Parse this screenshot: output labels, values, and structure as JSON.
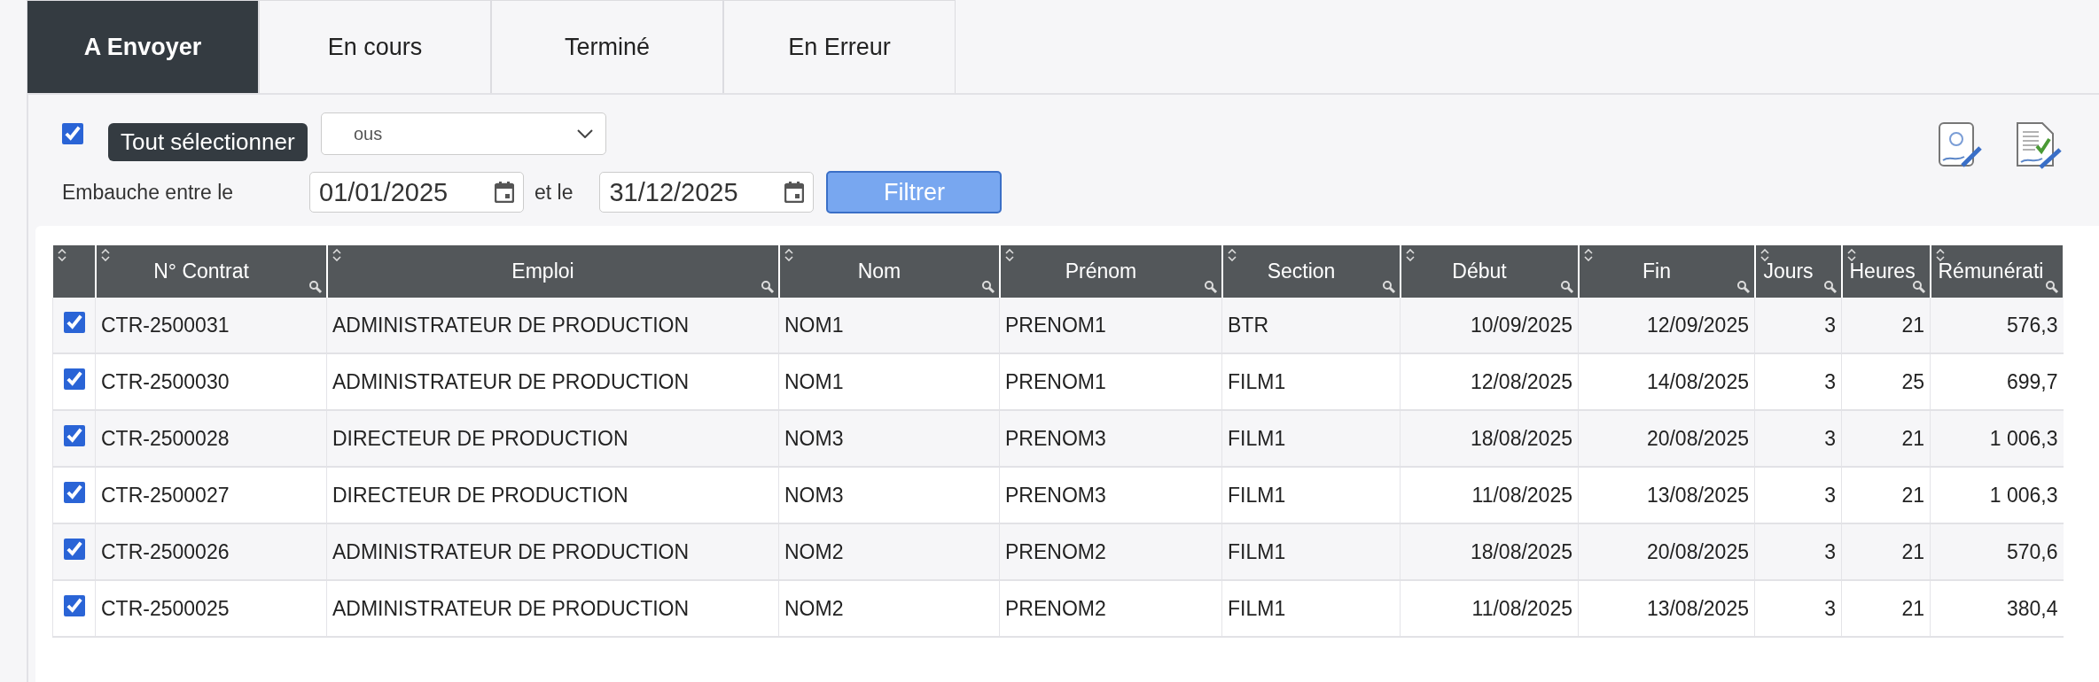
{
  "tabs": [
    {
      "label": "A Envoyer",
      "selected": true
    },
    {
      "label": "En cours",
      "selected": false
    },
    {
      "label": "Terminé",
      "selected": false
    },
    {
      "label": "En Erreur",
      "selected": false
    }
  ],
  "select_all": {
    "checked": true,
    "tooltip": "Tout sélectionner"
  },
  "status_select": {
    "value": "ous"
  },
  "hire_filter": {
    "label": "Embauche entre le",
    "from": "01/01/2025",
    "and_label": "et le",
    "to": "31/12/2025",
    "button": "Filtrer"
  },
  "table": {
    "columns": [
      {
        "label": "N° Contrat"
      },
      {
        "label": "Emploi"
      },
      {
        "label": "Nom"
      },
      {
        "label": "Prénom"
      },
      {
        "label": "Section"
      },
      {
        "label": "Début"
      },
      {
        "label": "Fin"
      },
      {
        "label": "Jours"
      },
      {
        "label": "Heures"
      },
      {
        "label": "Rémunérati"
      }
    ],
    "rows": [
      {
        "checked": true,
        "cells": [
          "CTR-2500031",
          "ADMINISTRATEUR DE PRODUCTION",
          "NOM1",
          "PRENOM1",
          "BTR",
          "10/09/2025",
          "12/09/2025",
          "3",
          "21",
          "576,3"
        ]
      },
      {
        "checked": true,
        "cells": [
          "CTR-2500030",
          "ADMINISTRATEUR DE PRODUCTION",
          "NOM1",
          "PRENOM1",
          "FILM1",
          "12/08/2025",
          "14/08/2025",
          "3",
          "25",
          "699,7"
        ]
      },
      {
        "checked": true,
        "cells": [
          "CTR-2500028",
          "DIRECTEUR DE PRODUCTION",
          "NOM3",
          "PRENOM3",
          "FILM1",
          "18/08/2025",
          "20/08/2025",
          "3",
          "21",
          "1 006,3"
        ]
      },
      {
        "checked": true,
        "cells": [
          "CTR-2500027",
          "DIRECTEUR DE PRODUCTION",
          "NOM3",
          "PRENOM3",
          "FILM1",
          "11/08/2025",
          "13/08/2025",
          "3",
          "21",
          "1 006,3"
        ]
      },
      {
        "checked": true,
        "cells": [
          "CTR-2500026",
          "ADMINISTRATEUR DE PRODUCTION",
          "NOM2",
          "PRENOM2",
          "FILM1",
          "18/08/2025",
          "20/08/2025",
          "3",
          "21",
          "570,6"
        ]
      },
      {
        "checked": true,
        "cells": [
          "CTR-2500025",
          "ADMINISTRATEUR DE PRODUCTION",
          "NOM2",
          "PRENOM2",
          "FILM1",
          "11/08/2025",
          "13/08/2025",
          "3",
          "21",
          "380,4"
        ]
      }
    ]
  }
}
